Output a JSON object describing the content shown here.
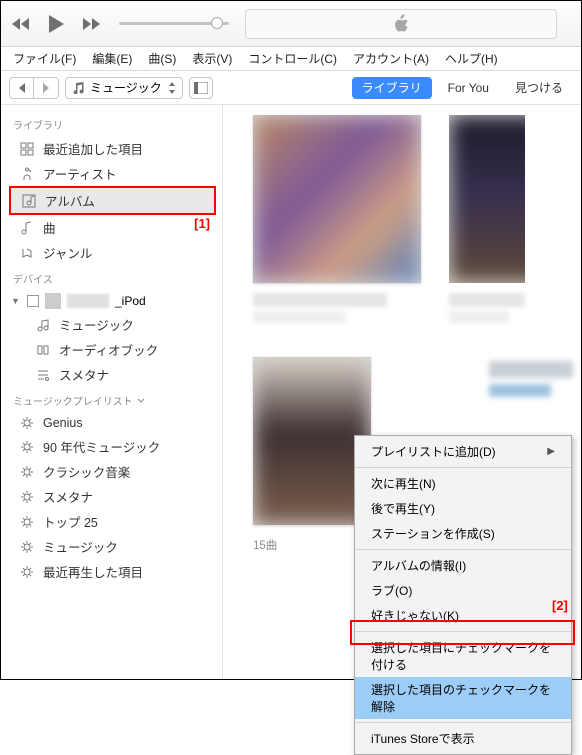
{
  "menubar": {
    "file": "ファイル(F)",
    "edit": "編集(E)",
    "song": "曲(S)",
    "view": "表示(V)",
    "control": "コントロール(C)",
    "account": "アカウント(A)",
    "help": "ヘルプ(H)"
  },
  "toolbar": {
    "media_select": "ミュージック",
    "tab_library": "ライブラリ",
    "tab_foryou": "For You",
    "tab_browse": "見つける"
  },
  "sidebar": {
    "section_library": "ライブラリ",
    "lib": {
      "recent": "最近追加した項目",
      "artists": "アーティスト",
      "albums": "アルバム",
      "songs": "曲",
      "genres": "ジャンル"
    },
    "section_devices": "デバイス",
    "device_name_suffix": "_iPod",
    "dev": {
      "music": "ミュージック",
      "audiobook": "オーディオブック",
      "smetana": "スメタナ"
    },
    "section_playlists": "ミュージックプレイリスト",
    "pl": {
      "genius": "Genius",
      "90s": "90 年代ミュージック",
      "classical": "クラシック音楽",
      "smetana": "スメタナ",
      "top25": "トップ 25",
      "music": "ミュージック",
      "recent_played": "最近再生した項目"
    }
  },
  "content": {
    "track_count": "15曲"
  },
  "context_menu": {
    "add_playlist": "プレイリストに追加(D)",
    "play_next": "次に再生(N)",
    "play_later": "後で再生(Y)",
    "create_station": "ステーションを作成(S)",
    "album_info": "アルバムの情報(I)",
    "love": "ラブ(O)",
    "dislike": "好きじゃない(K)",
    "check_selected": "選択した項目にチェックマークを付ける",
    "uncheck_selected": "選択した項目のチェックマークを解除",
    "show_store": "iTunes Storeで表示"
  },
  "markers": {
    "m1": "[1]",
    "m2": "[2]"
  }
}
